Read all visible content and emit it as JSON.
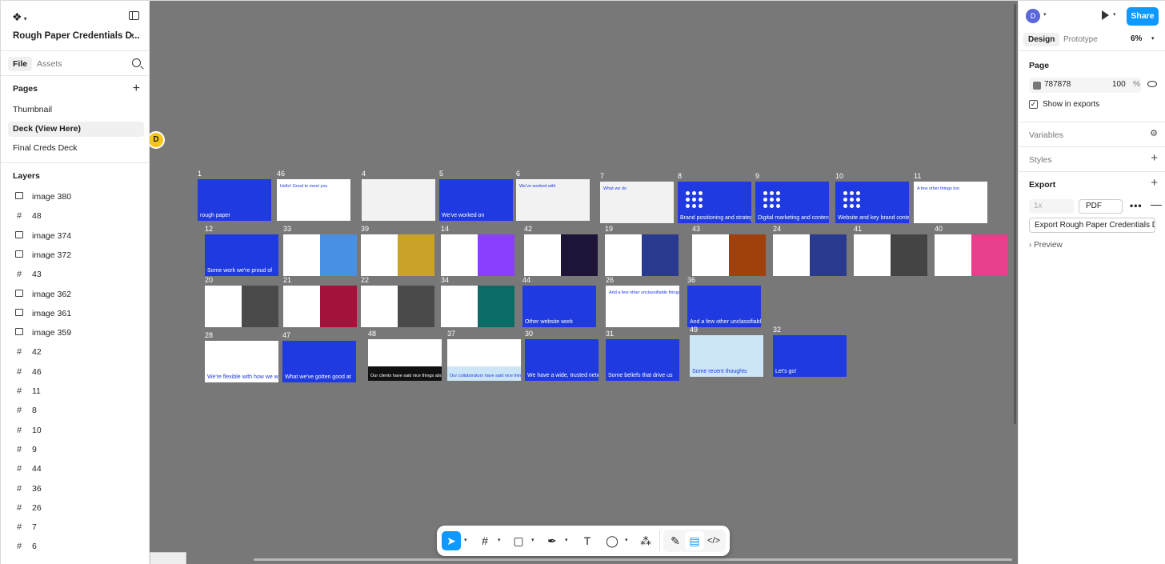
{
  "file": {
    "title": "Rough Paper Credentials D...",
    "tabs": {
      "file": "File",
      "assets": "Assets"
    }
  },
  "pages": {
    "title": "Pages",
    "items": [
      "Thumbnail",
      "Deck (View Here)",
      "Final Creds Deck"
    ],
    "selected_index": 1
  },
  "layers": {
    "title": "Layers",
    "items": [
      {
        "label": "image 380",
        "icon": "image-icon"
      },
      {
        "label": "48",
        "icon": "frame-icon"
      },
      {
        "label": "image 374",
        "icon": "image-icon"
      },
      {
        "label": "image 372",
        "icon": "image-icon"
      },
      {
        "label": "43",
        "icon": "frame-icon"
      },
      {
        "label": "image 362",
        "icon": "image-icon"
      },
      {
        "label": "image 361",
        "icon": "image-icon"
      },
      {
        "label": "image 359",
        "icon": "image-icon"
      },
      {
        "label": "42",
        "icon": "frame-icon"
      },
      {
        "label": "46",
        "icon": "frame-icon"
      },
      {
        "label": "11",
        "icon": "frame-icon"
      },
      {
        "label": "8",
        "icon": "frame-icon"
      },
      {
        "label": "10",
        "icon": "frame-icon"
      },
      {
        "label": "9",
        "icon": "frame-icon"
      },
      {
        "label": "44",
        "icon": "frame-icon"
      },
      {
        "label": "36",
        "icon": "frame-icon"
      },
      {
        "label": "26",
        "icon": "frame-icon"
      },
      {
        "label": "7",
        "icon": "frame-icon"
      },
      {
        "label": "6",
        "icon": "frame-icon"
      }
    ]
  },
  "canvas": {
    "background": "#787878",
    "collaborator_initial": "D",
    "slides": [
      {
        "label": "1",
        "style": "blue",
        "text": "rough paper"
      },
      {
        "label": "46",
        "style": "white",
        "text": "Hello! Good to meet you"
      },
      {
        "label": "4",
        "style": "grey",
        "text": ""
      },
      {
        "label": "5",
        "style": "blue",
        "text": "We've worked on"
      },
      {
        "label": "6",
        "style": "grey",
        "text": "We've worked with"
      },
      {
        "label": "7",
        "style": "grey",
        "text": "What we do"
      },
      {
        "label": "8",
        "style": "blue-dots",
        "text": "Brand positioning and strategy"
      },
      {
        "label": "9",
        "style": "blue-dots",
        "text": "Digital marketing and content strategy"
      },
      {
        "label": "10",
        "style": "blue-dots",
        "text": "Website and key brand content"
      },
      {
        "label": "11",
        "style": "white",
        "text": "A few other things too"
      },
      {
        "label": "12",
        "style": "blue",
        "text": "Some work we're proud of"
      },
      {
        "label": "33",
        "style": "split-lightblue",
        "text": ""
      },
      {
        "label": "39",
        "style": "split-gold",
        "text": ""
      },
      {
        "label": "14",
        "style": "split-purple",
        "text": ""
      },
      {
        "label": "42",
        "style": "split-dark",
        "text": ""
      },
      {
        "label": "19",
        "style": "split-navy",
        "text": ""
      },
      {
        "label": "43",
        "style": "split-rust",
        "text": ""
      },
      {
        "label": "24",
        "style": "split-navy",
        "text": ""
      },
      {
        "label": "41",
        "style": "split-darkgrey",
        "text": ""
      },
      {
        "label": "40",
        "style": "split-pink",
        "text": ""
      },
      {
        "label": "20",
        "style": "split-charcoal",
        "text": ""
      },
      {
        "label": "21",
        "style": "split-crimson",
        "text": ""
      },
      {
        "label": "22",
        "style": "split-charcoal",
        "text": ""
      },
      {
        "label": "34",
        "style": "split-teal",
        "text": ""
      },
      {
        "label": "44",
        "style": "blue",
        "text": "Other website work"
      },
      {
        "label": "26",
        "style": "white",
        "text": "And a few other unclassifiable things!"
      },
      {
        "label": "36",
        "style": "blue",
        "text": "And a few other unclassifiable things!"
      },
      {
        "label": "28",
        "style": "white",
        "text": "We're flexible with how we work"
      },
      {
        "label": "47",
        "style": "blue",
        "text": "What we've gotten good at"
      },
      {
        "label": "48",
        "style": "white-black",
        "text": "Our clients have said nice things about us"
      },
      {
        "label": "37",
        "style": "white-lightblue",
        "text": "Our collaborators have said nice things about us"
      },
      {
        "label": "30",
        "style": "blue",
        "text": "We have a wide, trusted network"
      },
      {
        "label": "31",
        "style": "blue",
        "text": "Some beliefs that drive us"
      },
      {
        "label": "49",
        "style": "lightblue",
        "text": "Some recent thoughts"
      },
      {
        "label": "32",
        "style": "blue",
        "text": "Let's go!"
      }
    ]
  },
  "toolbar": {
    "tools": [
      "move-tool",
      "frame-tool",
      "shape-tool",
      "pen-tool",
      "text-tool",
      "comment-tool",
      "actions-tool",
      "draw-mode",
      "design-mode",
      "dev-mode"
    ],
    "text_tool_label": "T"
  },
  "right_panel": {
    "user_initial": "D",
    "share_label": "Share",
    "tabs": {
      "design": "Design",
      "prototype": "Prototype"
    },
    "zoom": "6%",
    "page": {
      "title": "Page",
      "color_hex": "787878",
      "opacity": "100",
      "opacity_unit": "%",
      "show_in_exports": "Show in exports"
    },
    "variables": "Variables",
    "styles": "Styles",
    "export": {
      "title": "Export",
      "scale": "1x",
      "format": "PDF",
      "button": "Export Rough Paper Credentials D...",
      "preview": "Preview"
    }
  },
  "help_label": "?"
}
